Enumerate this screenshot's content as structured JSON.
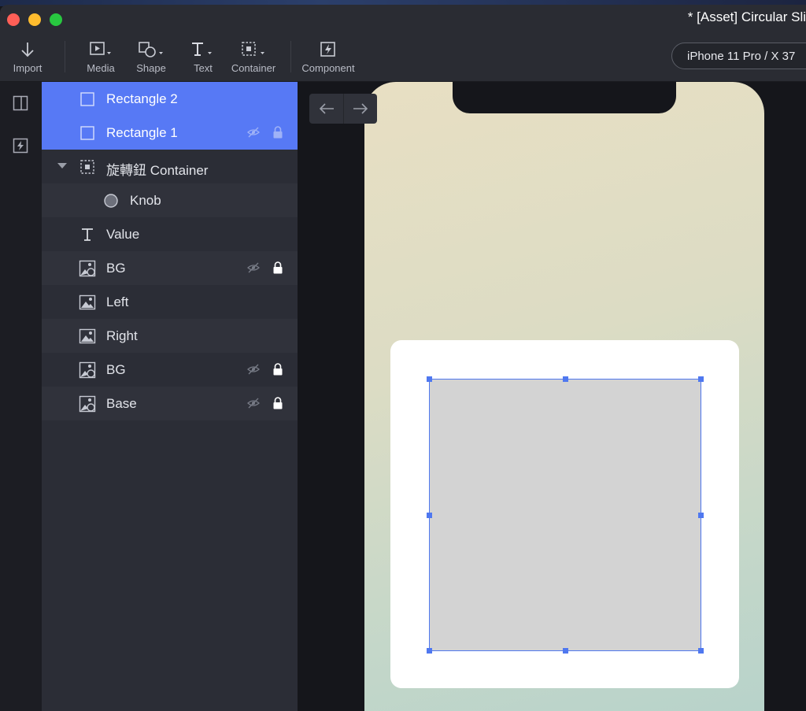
{
  "window": {
    "title": "* [Asset] Circular Sli"
  },
  "toolbar": {
    "tools": [
      {
        "label": "Import",
        "icon": "arrow-down-icon"
      },
      {
        "label": "Media",
        "icon": "media-play-icon"
      },
      {
        "label": "Shape",
        "icon": "shape-icon"
      },
      {
        "label": "Text",
        "icon": "text-icon"
      },
      {
        "label": "Container",
        "icon": "container-icon"
      },
      {
        "label": "Component",
        "icon": "component-bolt-icon"
      }
    ],
    "device_select": "iPhone 11 Pro / X  37"
  },
  "layers": [
    {
      "name": "Rectangle 2",
      "icon": "rectangle-icon",
      "selected": true,
      "hidden": false,
      "locked": false
    },
    {
      "name": "Rectangle 1",
      "icon": "rectangle-icon",
      "selected": true,
      "hidden": true,
      "locked": true
    },
    {
      "name": "旋轉鈕 Container",
      "icon": "container-icon",
      "selected": false,
      "expanded": true
    },
    {
      "name": "Knob",
      "icon": "circle-icon",
      "selected": false
    },
    {
      "name": "Value",
      "icon": "text-icon",
      "selected": false
    },
    {
      "name": "BG",
      "icon": "image-shape-icon",
      "selected": false,
      "hidden": true,
      "locked": true
    },
    {
      "name": "Left",
      "icon": "image-icon",
      "selected": false
    },
    {
      "name": "Right",
      "icon": "image-icon",
      "selected": false
    },
    {
      "name": "BG",
      "icon": "image-shape-icon",
      "selected": false,
      "hidden": true,
      "locked": true
    },
    {
      "name": "Base",
      "icon": "image-shape-icon",
      "selected": false,
      "hidden": true,
      "locked": true
    }
  ],
  "colors": {
    "accent": "#5779f5",
    "selection": "#4f78f0",
    "panel": "#2b2d36",
    "canvas": "#15161b"
  }
}
